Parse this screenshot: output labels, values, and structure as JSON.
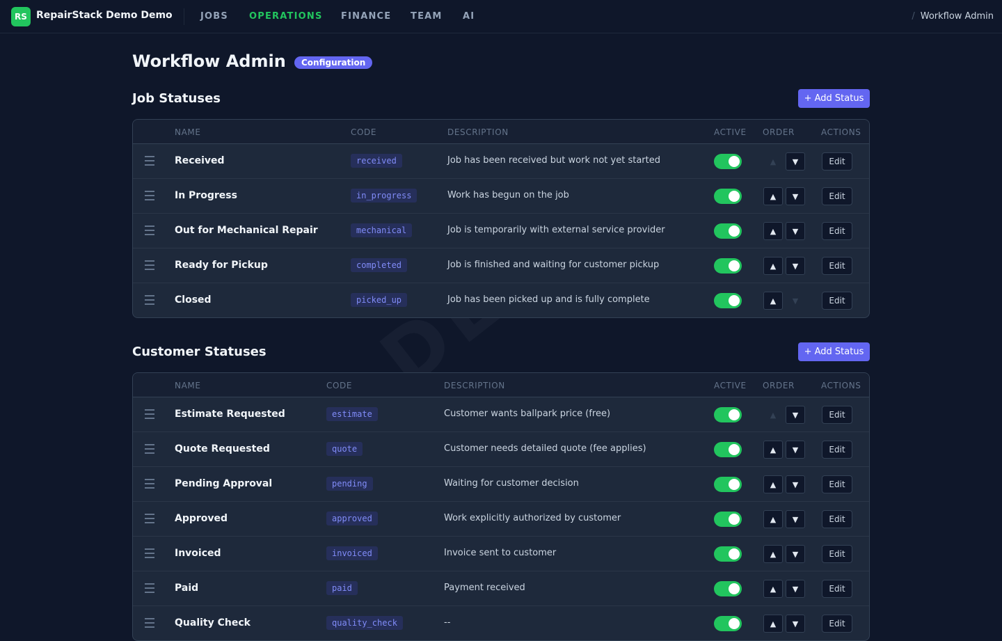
{
  "header": {
    "logo_text": "RS",
    "brand": "RepairStack Demo Demo",
    "nav": [
      {
        "label": "JOBS"
      },
      {
        "label": "OPERATIONS"
      },
      {
        "label": "FINANCE"
      },
      {
        "label": "TEAM"
      },
      {
        "label": "AI"
      }
    ],
    "active_nav": "OPERATIONS",
    "breadcrumb_sep": "/",
    "breadcrumb": "Workflow Admin"
  },
  "page": {
    "title": "Workflow Admin",
    "badge": "Configuration",
    "watermark": "DEMO"
  },
  "job_statuses": {
    "title": "Job Statuses",
    "add_label": "+ Add Status",
    "columns": [
      "NAME",
      "CODE",
      "DESCRIPTION",
      "ACTIVE",
      "ORDER",
      "ACTIONS"
    ],
    "rows": [
      {
        "name": "Received",
        "code": "received",
        "description": "Job has been received but work not yet started",
        "active": true,
        "up": false,
        "down": true
      },
      {
        "name": "In Progress",
        "code": "in_progress",
        "description": "Work has begun on the job",
        "active": true,
        "up": true,
        "down": true
      },
      {
        "name": "Out for Mechanical Repair",
        "code": "mechanical",
        "description": "Job is temporarily with external service provider",
        "active": true,
        "up": true,
        "down": true
      },
      {
        "name": "Ready for Pickup",
        "code": "completed",
        "description": "Job is finished and waiting for customer pickup",
        "active": true,
        "up": true,
        "down": true
      },
      {
        "name": "Closed",
        "code": "picked_up",
        "description": "Job has been picked up and is fully complete",
        "active": true,
        "up": true,
        "down": false
      }
    ]
  },
  "customer_statuses": {
    "title": "Customer Statuses",
    "add_label": "+ Add Status",
    "columns": [
      "NAME",
      "CODE",
      "DESCRIPTION",
      "ACTIVE",
      "ORDER",
      "ACTIONS"
    ],
    "rows": [
      {
        "name": "Estimate Requested",
        "code": "estimate",
        "description": "Customer wants ballpark price (free)",
        "active": true,
        "up": false,
        "down": true
      },
      {
        "name": "Quote Requested",
        "code": "quote",
        "description": "Customer needs detailed quote (fee applies)",
        "active": true,
        "up": true,
        "down": true
      },
      {
        "name": "Pending Approval",
        "code": "pending",
        "description": "Waiting for customer decision",
        "active": true,
        "up": true,
        "down": true
      },
      {
        "name": "Approved",
        "code": "approved",
        "description": "Work explicitly authorized by customer",
        "active": true,
        "up": true,
        "down": true
      },
      {
        "name": "Invoiced",
        "code": "invoiced",
        "description": "Invoice sent to customer",
        "active": true,
        "up": true,
        "down": true
      },
      {
        "name": "Paid",
        "code": "paid",
        "description": "Payment received",
        "active": true,
        "up": true,
        "down": true
      },
      {
        "name": "Quality Check",
        "code": "quality_check",
        "description": "--",
        "active": true,
        "up": true,
        "down": true
      }
    ]
  },
  "labels": {
    "up": "▲",
    "down": "▼",
    "edit": "Edit"
  },
  "colors": {
    "accent": "#6366f1",
    "active_nav": "#22c55e",
    "toggle_on": "#22c55e",
    "background": "#0f172a"
  }
}
